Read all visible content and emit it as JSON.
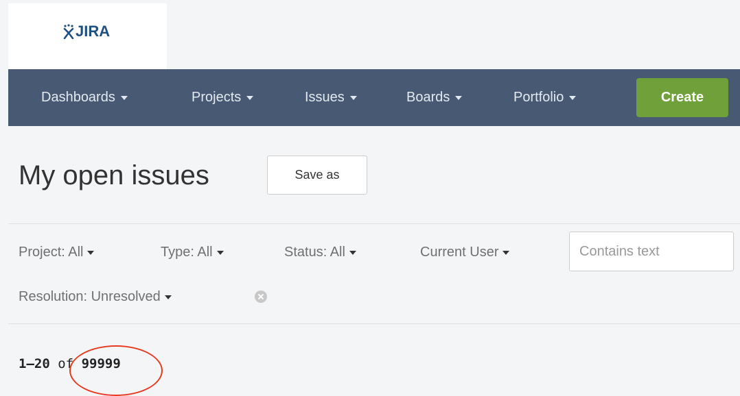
{
  "logo": {
    "text": "JIRA"
  },
  "nav": {
    "items": [
      {
        "label": "Dashboards"
      },
      {
        "label": "Projects"
      },
      {
        "label": "Issues"
      },
      {
        "label": "Boards"
      },
      {
        "label": "Portfolio"
      }
    ],
    "create_label": "Create"
  },
  "page": {
    "title": "My open issues",
    "save_as_label": "Save as"
  },
  "filters": {
    "project": "Project: All",
    "type": "Type: All",
    "status": "Status: All",
    "user": "Current User",
    "search_placeholder": "Contains text",
    "resolution": "Resolution: Unresolved"
  },
  "results": {
    "range": "1–20",
    "of": "of",
    "total": "99999"
  },
  "colors": {
    "navbar": "#485a73",
    "create": "#6fa039",
    "logo": "#205081",
    "highlight": "#e8391f"
  }
}
